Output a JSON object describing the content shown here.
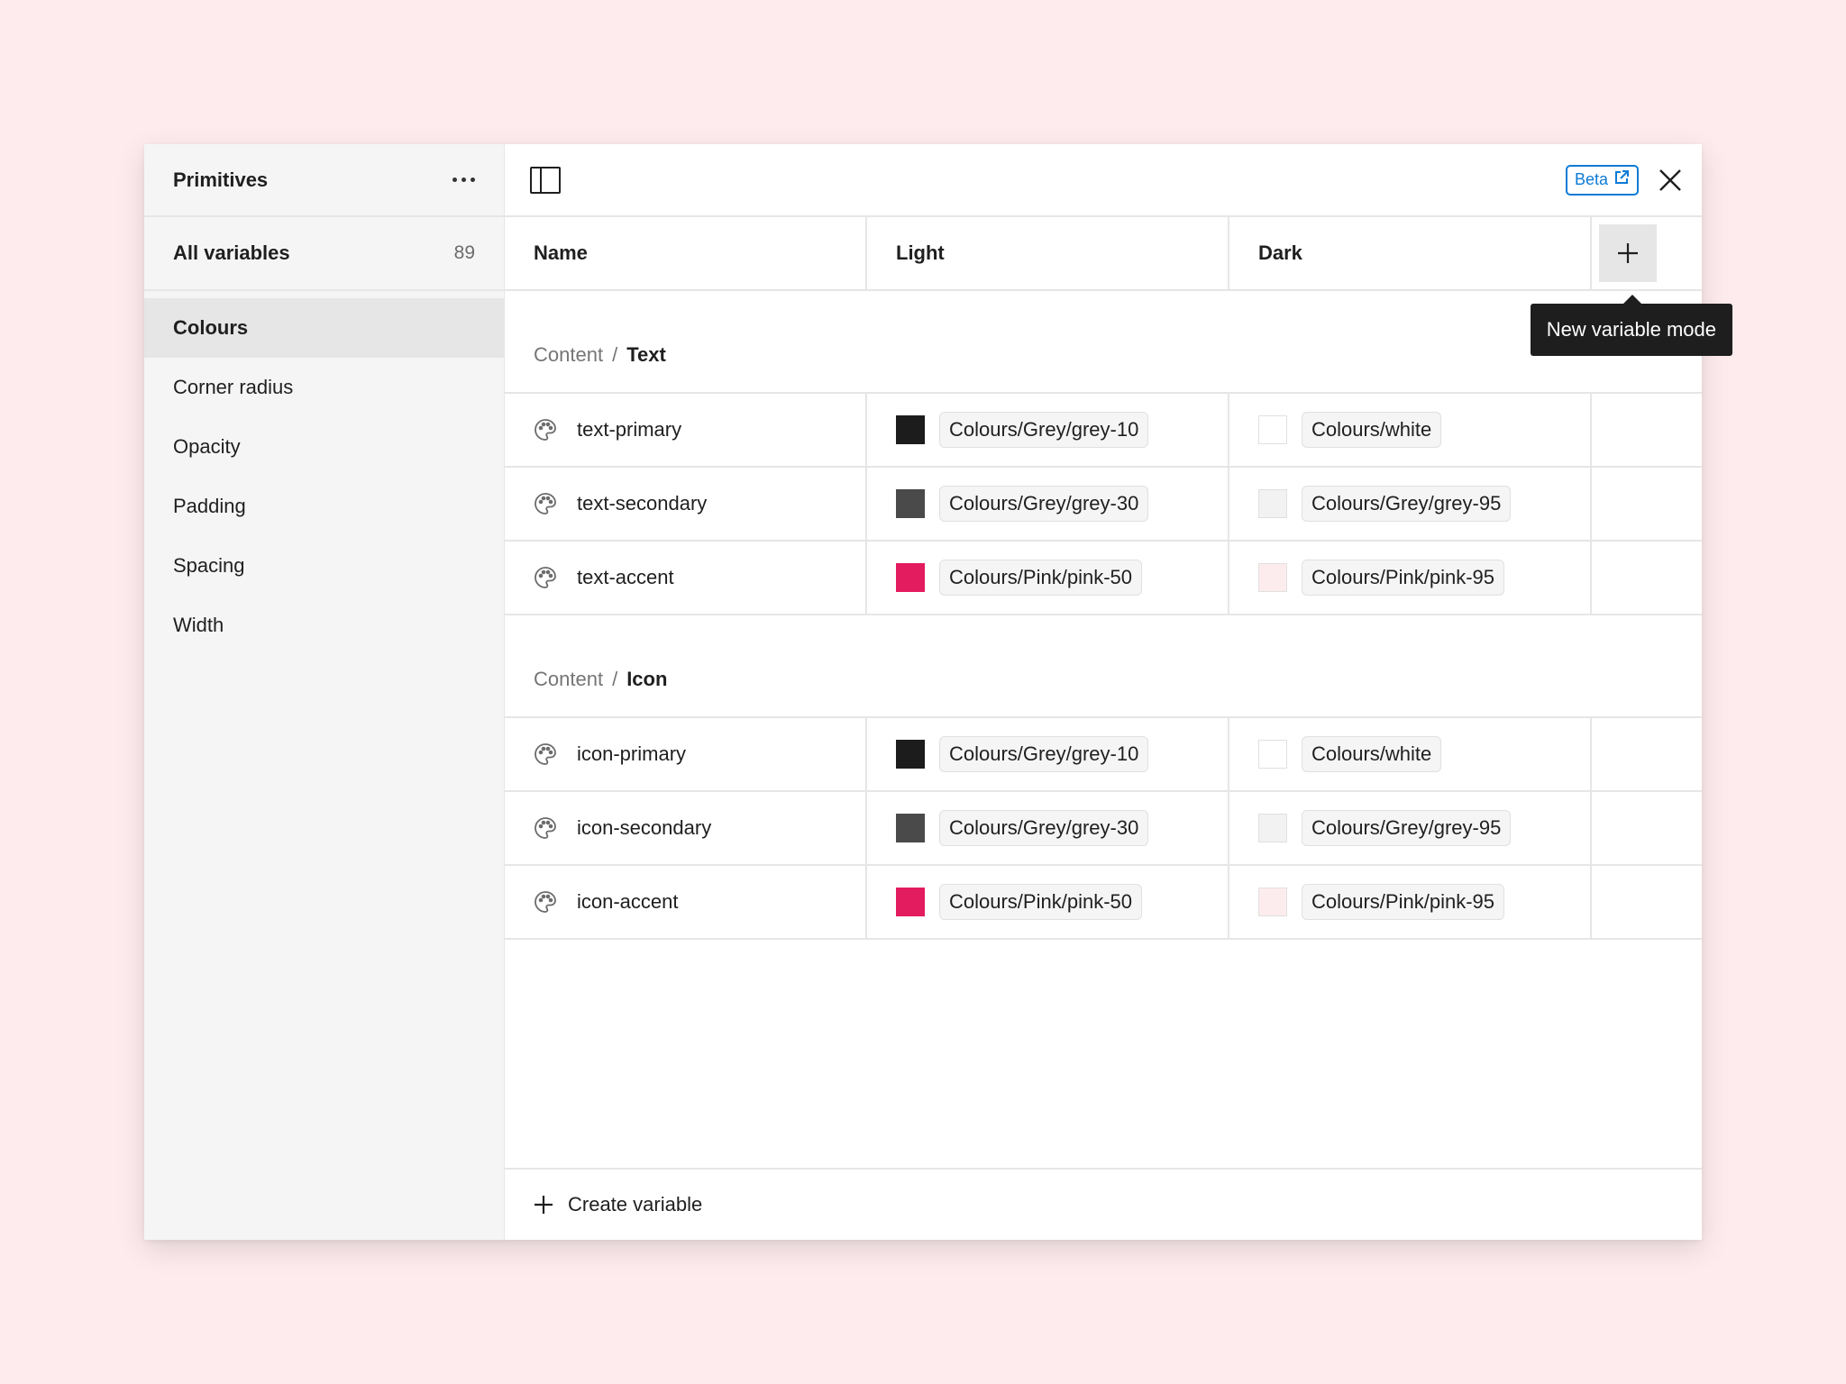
{
  "sidebar": {
    "title": "Primitives",
    "menu_icon": "more-horizontal-icon",
    "all_variables": {
      "label": "All variables",
      "count": "89"
    },
    "items": [
      {
        "label": "Colours",
        "active": true
      },
      {
        "label": "Corner radius"
      },
      {
        "label": "Opacity"
      },
      {
        "label": "Padding"
      },
      {
        "label": "Spacing"
      },
      {
        "label": "Width"
      }
    ]
  },
  "topbar": {
    "panel_icon": "sidebar-toggle-icon",
    "beta_label": "Beta",
    "beta_icon": "external-link-icon",
    "close_icon": "close-icon"
  },
  "table": {
    "columns": {
      "name": "Name",
      "light": "Light",
      "dark": "Dark"
    },
    "add_mode_tooltip": "New variable mode",
    "groups": [
      {
        "crumb": "Content",
        "separator": "/",
        "leaf": "Text",
        "rows": [
          {
            "name": "text-primary",
            "light": {
              "color": "#1c1c1c",
              "value": "Colours/Grey/grey-10"
            },
            "dark": {
              "color": "#ffffff",
              "value": "Colours/white"
            }
          },
          {
            "name": "text-secondary",
            "light": {
              "color": "#4a4a4a",
              "value": "Colours/Grey/grey-30"
            },
            "dark": {
              "color": "#f2f2f2",
              "value": "Colours/Grey/grey-95"
            }
          },
          {
            "name": "text-accent",
            "light": {
              "color": "#e31b5f",
              "value": "Colours/Pink/pink-50"
            },
            "dark": {
              "color": "#fdecee",
              "value": "Colours/Pink/pink-95"
            }
          }
        ]
      },
      {
        "crumb": "Content",
        "separator": "/",
        "leaf": "Icon",
        "rows": [
          {
            "name": "icon-primary",
            "light": {
              "color": "#1c1c1c",
              "value": "Colours/Grey/grey-10"
            },
            "dark": {
              "color": "#ffffff",
              "value": "Colours/white"
            }
          },
          {
            "name": "icon-secondary",
            "light": {
              "color": "#4a4a4a",
              "value": "Colours/Grey/grey-30"
            },
            "dark": {
              "color": "#f2f2f2",
              "value": "Colours/Grey/grey-95"
            }
          },
          {
            "name": "icon-accent",
            "light": {
              "color": "#e31b5f",
              "value": "Colours/Pink/pink-50"
            },
            "dark": {
              "color": "#fdecee",
              "value": "Colours/Pink/pink-95"
            }
          }
        ]
      }
    ]
  },
  "footer": {
    "create_label": "Create variable"
  },
  "colors": {
    "accent": "#0d7bd6",
    "background": "#fdebed"
  }
}
